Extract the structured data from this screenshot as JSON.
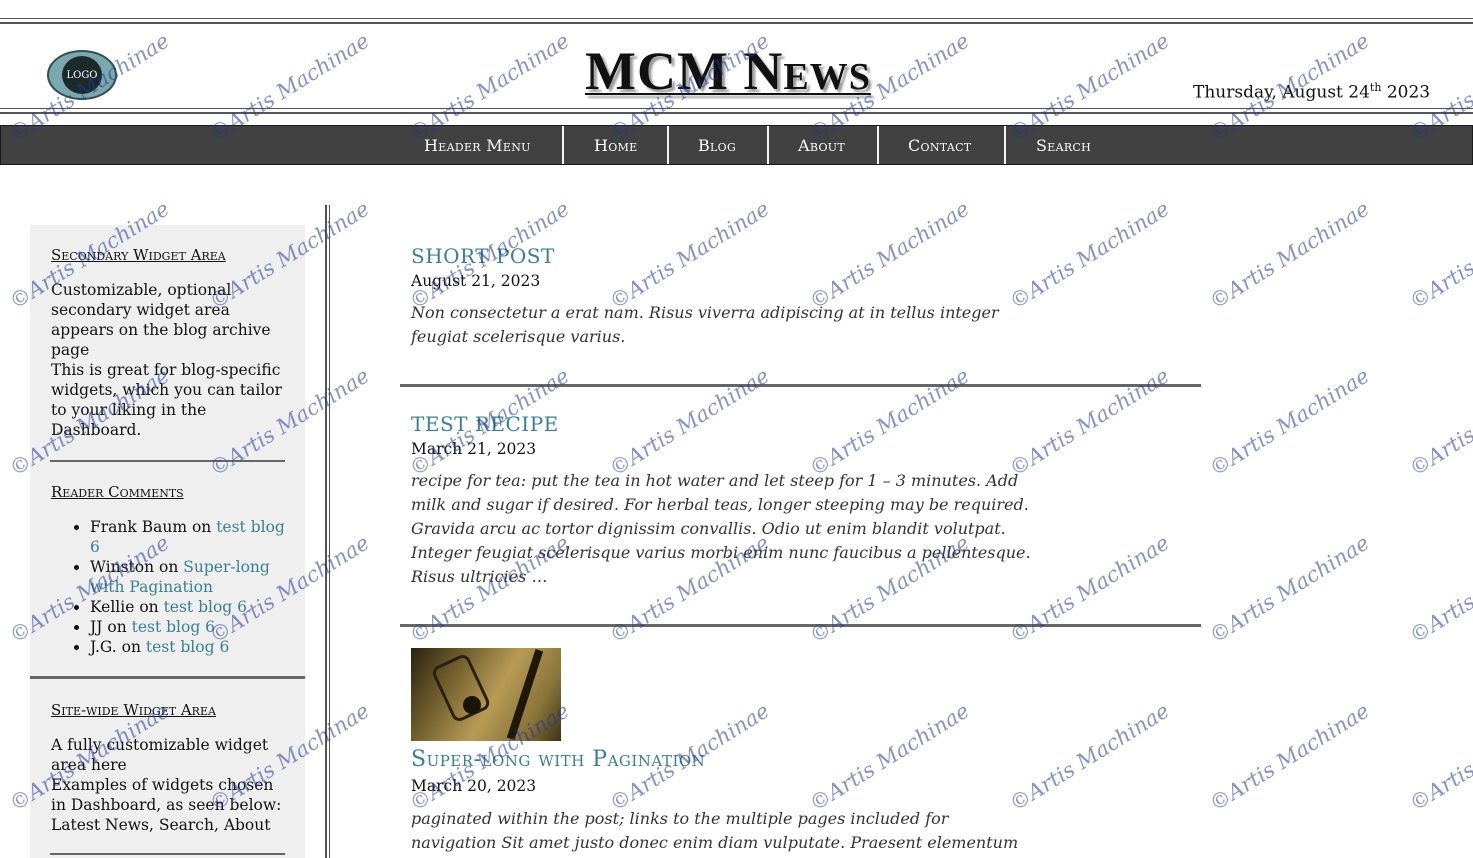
{
  "header": {
    "logo_text": "LOGO",
    "site_title": "MCM News",
    "date_prefix": "Thursday, August 24",
    "date_suffix": "th",
    "date_year": " 2023"
  },
  "nav": {
    "items": [
      {
        "label": "Header Menu"
      },
      {
        "label": "Home"
      },
      {
        "label": "Blog"
      },
      {
        "label": "About"
      },
      {
        "label": "Contact"
      },
      {
        "label": "Search"
      }
    ]
  },
  "sidebar": {
    "secondary": {
      "title": "Secondary Widget Area",
      "text": "Customizable, optional secondary widget area appears on the blog archive page",
      "text2": "This is great for blog-specific widgets, which you can tailor to your liking in the Dashboard."
    },
    "comments": {
      "title": "Reader Comments",
      "items": [
        {
          "author": "Frank Baum",
          "on": " on ",
          "link": "test blog 6"
        },
        {
          "author": "Winston",
          "on": " on ",
          "link": "Super-long with Pagination"
        },
        {
          "author": "Kellie",
          "on": " on ",
          "link": "test blog 6"
        },
        {
          "author": "JJ",
          "on": " on ",
          "link": "test blog 6"
        },
        {
          "author": "J.G.",
          "on": " on ",
          "link": "test blog 6"
        }
      ]
    },
    "sitewide": {
      "title": "Site-wide Widget Area",
      "text": "A fully customizable widget area here",
      "text2": "Examples of widgets chosen in Dashboard, as seen below: Latest News, Search, About"
    }
  },
  "posts": [
    {
      "title": "SHORT POST",
      "date": "August 21, 2023",
      "excerpt": "Non consectetur a erat nam. Risus viverra adipiscing at in tellus integer feugiat scelerisque varius."
    },
    {
      "title": "TEST RECIPE",
      "date": "March 21, 2023",
      "excerpt": "recipe for tea: put the tea in hot water and let steep for 1 – 3 minutes. Add milk and sugar if desired. For herbal teas, longer steeping may be required.   Gravida arcu ac tortor dignissim convallis. Odio ut enim blandit volutpat. Integer feugiat scelerisque varius morbi enim nunc faucibus a pellentesque. Risus ultricies  …"
    },
    {
      "title": "Super-long with Pagination",
      "date": "March 20, 2023",
      "excerpt": "paginated within the post; links to the multiple pages included for navigation Sit amet justo donec enim diam vulputate. Praesent elementum"
    }
  ],
  "watermark": "©Artis Machinae",
  "colors": {
    "nav_bg": "#414141",
    "link": "#3a7f93",
    "sidebar_bg": "#efefef",
    "watermark": "#23379a"
  }
}
